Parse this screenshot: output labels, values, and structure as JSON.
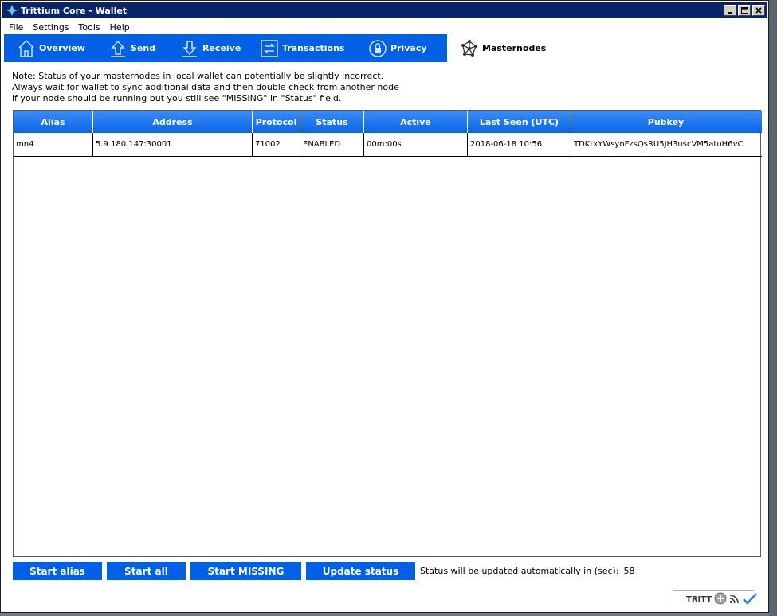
{
  "window": {
    "title": "Trittium Core - Wallet"
  },
  "menu": [
    "File",
    "Settings",
    "Tools",
    "Help"
  ],
  "tabs": [
    {
      "label": "Overview",
      "icon": "home-icon"
    },
    {
      "label": "Send",
      "icon": "send-icon"
    },
    {
      "label": "Receive",
      "icon": "receive-icon"
    },
    {
      "label": "Transactions",
      "icon": "transactions-icon"
    },
    {
      "label": "Privacy",
      "icon": "lock-icon"
    },
    {
      "label": "Masternodes",
      "icon": "masternodes-icon",
      "active": true
    }
  ],
  "note": {
    "line1": "Note: Status of your masternodes in local wallet can potentially be slightly incorrect.",
    "line2": "Always wait for wallet to sync additional data and then double check from another node",
    "line3": "if your node should be running but you still see \"MISSING\" in \"Status\" field."
  },
  "table": {
    "columns": [
      "Alias",
      "Address",
      "Protocol",
      "Status",
      "Active",
      "Last Seen (UTC)",
      "Pubkey"
    ],
    "rows": [
      [
        "mn4",
        "5.9.180.147:30001",
        "71002",
        "ENABLED",
        "00m:00s",
        "2018-06-18 10:56",
        "TDKtxYWsynFzsQsRU5JH3uscVM5atuH6vC"
      ]
    ]
  },
  "buttons": {
    "start_alias": "Start alias",
    "start_all": "Start all",
    "start_missing": "Start MISSING",
    "update_status": "Update status"
  },
  "status": {
    "label": "Status will be updated automatically in (sec):",
    "seconds": "58"
  },
  "statusbar": {
    "unit": "TRITT"
  },
  "colors": {
    "accent": "#0060e6",
    "titlebar": "#0a246a",
    "header_top": "#3a8ef5"
  }
}
